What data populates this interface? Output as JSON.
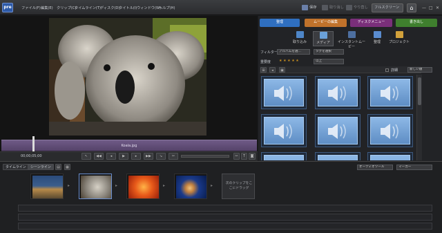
{
  "app": {
    "logo": "pre"
  },
  "menu": [
    "ファイル(F)",
    "編集(E)",
    "クリップ(C)",
    "タイムライン(T)",
    "ディスク(D)",
    "タイトル(I)",
    "ウィンドウ(W)",
    "ヘルプ(H)"
  ],
  "toolbar": {
    "save": "保存",
    "undo": "取り消し",
    "redo": "やり直し",
    "fullscreen": "フルスクリーン"
  },
  "monitor": {
    "clip_name": "Koala.jpg",
    "timecode": "00;00;05;00"
  },
  "main_tabs": [
    {
      "label": "整理",
      "color": "#2f6fc0"
    },
    {
      "label": "ムービーの編集",
      "color": "#c0722b"
    },
    {
      "label": "ディスクメニュー",
      "color": "#7a2f7a"
    },
    {
      "label": "書き出し",
      "color": "#3f7f2e"
    }
  ],
  "organize_tools": [
    "取り込み",
    "メディア",
    "インスタントムービー",
    "整理",
    "プロジェクト"
  ],
  "filters": {
    "filter_label": "フィルター",
    "album_select": "アルバムを選...",
    "tag_select": "タグを選択",
    "rating_label": "重要度",
    "rating_stars": "★ ★ ★ ★ ★",
    "rating_condition": "以上",
    "details_label": "詳細",
    "sort_select": "新しい順"
  },
  "bottom_tabs": {
    "timeline": "タイムライン",
    "sceneline": "シーンライン"
  },
  "audio_tools": "オーディオツール",
  "markers": "マーカー",
  "sceneline_drop_hint": "次のクリップをここにドラッグ",
  "colors": {
    "accent": "#2f6fc0",
    "clip_strip": "#6f5a86",
    "media_tile": "#5e8dc4"
  },
  "icons": [
    "speaker-icon",
    "play-icon",
    "home-icon",
    "save-icon",
    "undo-icon",
    "redo-icon"
  ]
}
